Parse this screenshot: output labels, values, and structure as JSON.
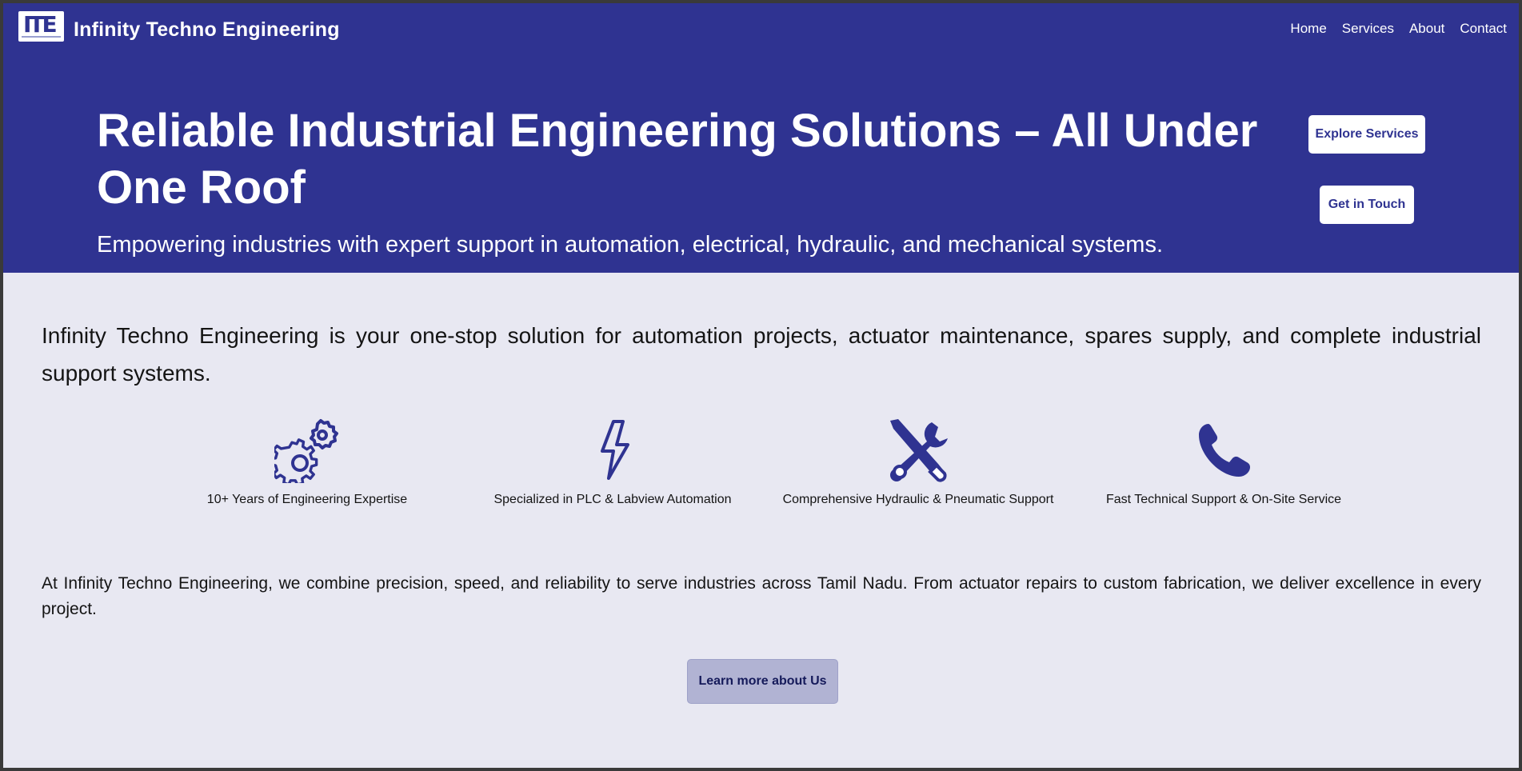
{
  "header": {
    "logo_text": "ITE",
    "brand": "Infinity Techno Engineering",
    "nav": [
      "Home",
      "Services",
      "About",
      "Contact"
    ]
  },
  "hero": {
    "title": "Reliable Industrial Engineering Solutions – All Under One Roof",
    "subtitle": "Empowering industries with expert support in automation, electrical, hydraulic, and mechanical systems.",
    "explore_label": "Explore Services",
    "touch_label": "Get in Touch"
  },
  "intro": "Infinity Techno Engineering is your one-stop solution for automation projects, actuator maintenance, spares supply, and complete industrial support systems.",
  "features": [
    {
      "icon": "gears-icon",
      "label": "10+ Years of Engineering Expertise"
    },
    {
      "icon": "lightning-bolt-icon",
      "label": "Specialized in PLC & Labview Automation"
    },
    {
      "icon": "tools-icon",
      "label": "Comprehensive Hydraulic & Pneumatic Support"
    },
    {
      "icon": "phone-icon",
      "label": "Fast Technical Support & On-Site Service"
    }
  ],
  "about": "At Infinity Techno Engineering, we combine precision, speed, and reliability to serve industries across Tamil Nadu. From actuator repairs to custom fabrication, we deliver excellence in every project.",
  "learn_label": "Learn more about Us",
  "colors": {
    "primary": "#2f3391",
    "background": "#e8e8f2",
    "button_light": "#b1b3d3"
  }
}
